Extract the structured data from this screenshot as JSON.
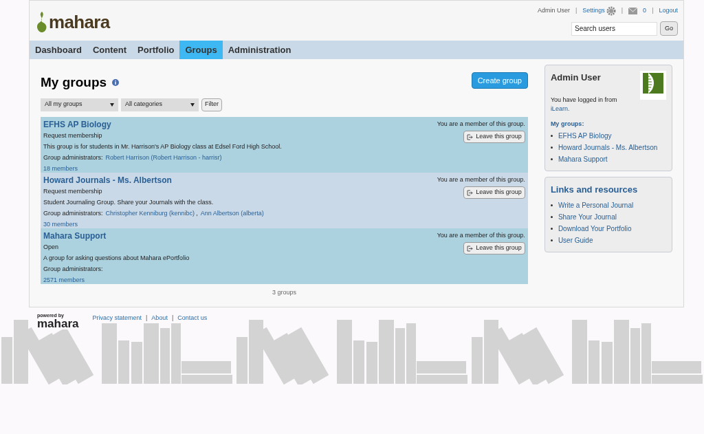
{
  "header": {
    "logo": "mahara",
    "user": "Admin User",
    "settings": "Settings",
    "inbox_count": "0",
    "logout": "Logout",
    "separator": "|",
    "search": {
      "placeholder": "Search users"
    },
    "go": "Go"
  },
  "nav": [
    {
      "label": "Dashboard",
      "selected": false
    },
    {
      "label": "Content",
      "selected": false
    },
    {
      "label": "Portfolio",
      "selected": false
    },
    {
      "label": "Groups",
      "selected": true
    },
    {
      "label": "Administration",
      "selected": false
    }
  ],
  "page": {
    "title": "My groups",
    "create": "Create group",
    "filters": [
      "All my groups",
      "All categories"
    ],
    "filter_button": "Filter",
    "groups": [
      {
        "name": "EFHS AP Biology",
        "join": "Request membership",
        "description": "This group is for students in Mr. Harrison's AP Biology class at Edsel Ford High School.",
        "admins_label": "Group administrators:",
        "admins": [
          "Robert Harrison (Robert Harrison - harrisr)"
        ],
        "members": "18 members",
        "status": "You are a member of this group.",
        "action": "Leave this group"
      },
      {
        "name": "Howard Journals - Ms. Albertson",
        "join": "Request membership",
        "description": "Student Journaling Group.  Share your Journals with the class.",
        "admins_label": "Group administrators:",
        "admins": [
          "Christopher Kenniburg (kennibc)",
          "Ann Albertson (alberta)"
        ],
        "admin_separator": ",",
        "members": "30 members",
        "status": "You are a member of this group.",
        "action": "Leave this group"
      },
      {
        "name": "Mahara Support",
        "join": "Open",
        "description": "A group for asking questions about Mahara ePortfolio",
        "admins_label": "Group administrators:",
        "members": "2571 members",
        "status": "You are a member of this group.",
        "action": "Leave this group"
      }
    ],
    "count": "3 groups"
  },
  "sidebar": {
    "profile": {
      "title": "Admin User",
      "text": "You have logged in from",
      "link": "iLearn.",
      "groups_title": "My groups:",
      "groups": [
        "EFHS AP Biology",
        "Howard Journals - Ms. Albertson",
        "Mahara Support"
      ]
    },
    "links": {
      "title": "Links and resources",
      "items": [
        "Write a Personal Journal",
        "Share Your Journal",
        "Download Your Portfolio",
        "User Guide"
      ]
    }
  },
  "footer": {
    "powered": "powered by",
    "logo": "mahara",
    "links": [
      "Privacy statement",
      "About",
      "Contact us"
    ],
    "separator": "|"
  }
}
